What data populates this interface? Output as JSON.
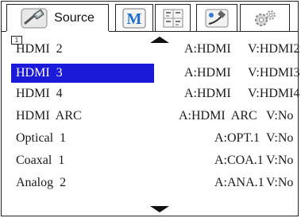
{
  "tabs": [
    {
      "label": "Source",
      "icon": "hdmi-cable-icon",
      "active": true
    },
    {
      "label": "",
      "icon": "m-logo-icon",
      "active": false
    },
    {
      "label": "",
      "icon": "grid-table-icon",
      "active": false
    },
    {
      "label": "",
      "icon": "network-plug-icon",
      "active": false
    },
    {
      "label": "",
      "icon": "settings-gears-icon",
      "active": false
    }
  ],
  "page_indicator": "1",
  "rows": [
    {
      "name": "HDMI  2",
      "audio": "A:HDMI",
      "video": "V:HDMI2",
      "selected": false
    },
    {
      "name": "HDMI  3",
      "audio": "A:HDMI",
      "video": "V:HDMI3",
      "selected": true
    },
    {
      "name": "HDMI  4",
      "audio": "A:HDMI",
      "video": "V:HDMI4",
      "selected": false
    },
    {
      "name": "HDMI  ARC",
      "audio": "A:HDMI  ARC",
      "video": "V:No",
      "selected": false
    },
    {
      "name": "Optical  1",
      "audio": "A:OPT.1",
      "video": "V:No",
      "selected": false
    },
    {
      "name": "Coaxal  1",
      "audio": "A:COA.1",
      "video": "V:No",
      "selected": false
    },
    {
      "name": "Analog  2",
      "audio": "A:ANA.1",
      "video": "V:No",
      "selected": false
    }
  ],
  "colors": {
    "selection": "#1a1ad8",
    "selected_text": "#ffffff",
    "brand_m": "#1e6fd0"
  }
}
